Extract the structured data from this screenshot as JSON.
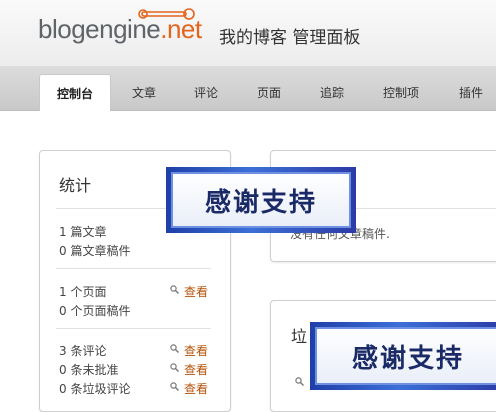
{
  "header": {
    "logo_main": "blogengine",
    "logo_suffix": ".net",
    "site_title": "我的博客 管理面板"
  },
  "tabs": [
    {
      "label": "控制台",
      "active": true
    },
    {
      "label": "文章",
      "active": false
    },
    {
      "label": "评论",
      "active": false
    },
    {
      "label": "页面",
      "active": false
    },
    {
      "label": "追踪",
      "active": false
    },
    {
      "label": "控制项",
      "active": false
    },
    {
      "label": "插件",
      "active": false
    }
  ],
  "stats": {
    "title": "统计",
    "groups": [
      [
        {
          "text": "1 篇文章",
          "link": "查看"
        },
        {
          "text": "0 篇文章稿件",
          "link": ""
        }
      ],
      [
        {
          "text": "1 个页面",
          "link": "查看"
        },
        {
          "text": "0 个页面稿件",
          "link": ""
        }
      ],
      [
        {
          "text": "3 条评论",
          "link": "查看"
        },
        {
          "text": "0 条未批准",
          "link": "查看"
        },
        {
          "text": "0 条垃圾评论",
          "link": "查看"
        }
      ]
    ]
  },
  "drafts": {
    "text": "没有任何文章稿件."
  },
  "spam": {
    "title_partial": "垃"
  },
  "banners": [
    {
      "text": "感谢支持"
    },
    {
      "text": "感谢支持"
    }
  ],
  "colors": {
    "accent": "#e2641d",
    "link": "#b45309",
    "banner_blue": "#2f55c4"
  }
}
